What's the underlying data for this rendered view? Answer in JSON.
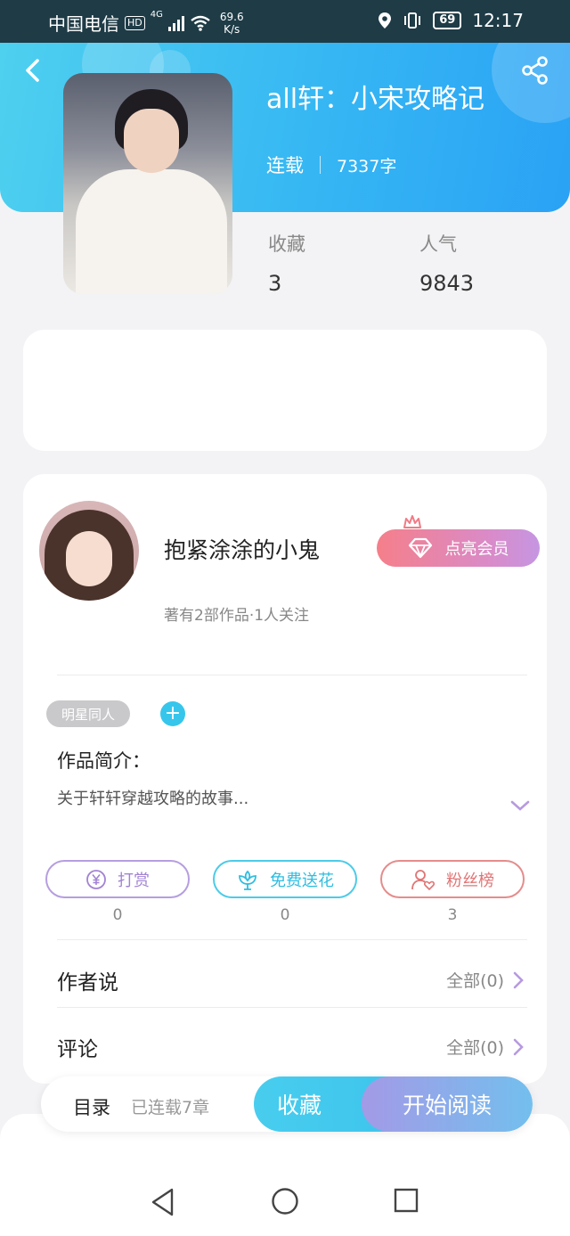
{
  "status_bar": {
    "carrier": "中国电信",
    "hd": "HD",
    "net": "4G",
    "speed_value": "69.6",
    "speed_unit": "K/s",
    "battery": "69",
    "time": "12:17"
  },
  "book": {
    "title": "all轩：小宋攻略记",
    "status": "连载",
    "word_count": "7337字",
    "stats": [
      {
        "label": "收藏",
        "value": "3"
      },
      {
        "label": "人气",
        "value": "9843"
      }
    ]
  },
  "author": {
    "name": "抱紧涂涂的小鬼",
    "sub": "著有2部作品·1人关注",
    "vip_label": "点亮会员"
  },
  "tags": [
    "明星同人"
  ],
  "intro": {
    "title": "作品简介：",
    "text": "关于轩轩穿越攻略的故事..."
  },
  "actions": [
    {
      "label": "打赏",
      "count": "0",
      "icon": "yuan-icon"
    },
    {
      "label": "免费送花",
      "count": "0",
      "icon": "flower-icon"
    },
    {
      "label": "粉丝榜",
      "count": "3",
      "icon": "fan-user-icon"
    }
  ],
  "rows": [
    {
      "label": "作者说",
      "right": "全部(0)"
    },
    {
      "label": "评论",
      "right": "全部(0)"
    }
  ],
  "bottom_bar": {
    "toc_label": "目录",
    "toc_sub": "已连载7章",
    "fav_label": "收藏",
    "read_label": "开始阅读"
  },
  "colors": {
    "header_start": "#4ed0ef",
    "header_end": "#2aa2f5",
    "accent_cyan": "#36c6ec",
    "vip_start": "#f57f8a",
    "vip_end": "#c596e2"
  }
}
